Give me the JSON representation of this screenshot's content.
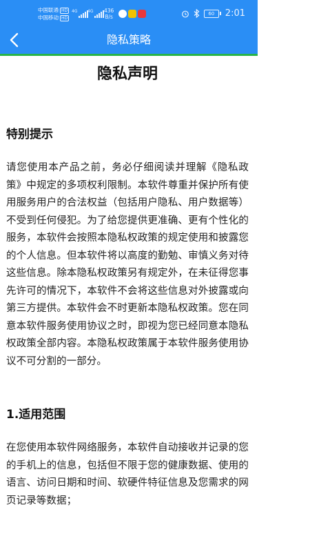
{
  "status_bar": {
    "carrier1": "中国联通",
    "carrier2": "中国移动",
    "hd_badge": "HD",
    "network1": "4G",
    "network2": "4G",
    "speed_value": "436",
    "speed_unit": "B/s",
    "battery_level": "60",
    "time": "2:01",
    "background_color": "#2a8ef5"
  },
  "nav_bar": {
    "back_icon": "chevron-left-icon",
    "title": "隐私策略",
    "background_color": "#2a8ef5",
    "underline_color": "#27b34a"
  },
  "document": {
    "title": "隐私声明",
    "sections": [
      {
        "heading": "特别提示",
        "body": "请您使用本产品之前，务必仔细阅读并理解《隐私政策》中规定的多项权利限制。本软件尊重并保护所有使用服务用户的合法权益（包括用户隐私、用户数据等）不受到任何侵犯。为了给您提供更准确、更有个性化的服务，本软件会按照本隐私权政策的规定使用和披露您的个人信息。但本软件将以高度的勤勉、审慎义务对待这些信息。除本隐私权政策另有规定外，在未征得您事先许可的情况下，本软件不会将这些信息对外披露或向第三方提供。本软件会不时更新本隐私权政策。您在同意本软件服务使用协议之时，即视为您已经同意本隐私权政策全部内容。本隐私权政策属于本软件服务使用协议不可分割的一部分。"
      },
      {
        "heading": "1.适用范围",
        "body": "在您使用本软件网络服务，本软件自动接收并记录的您的手机上的信息，包括但不限于您的健康数据、使用的语言、访问日期和时间、软硬件特征信息及您需求的网页记录等数据；"
      }
    ]
  }
}
